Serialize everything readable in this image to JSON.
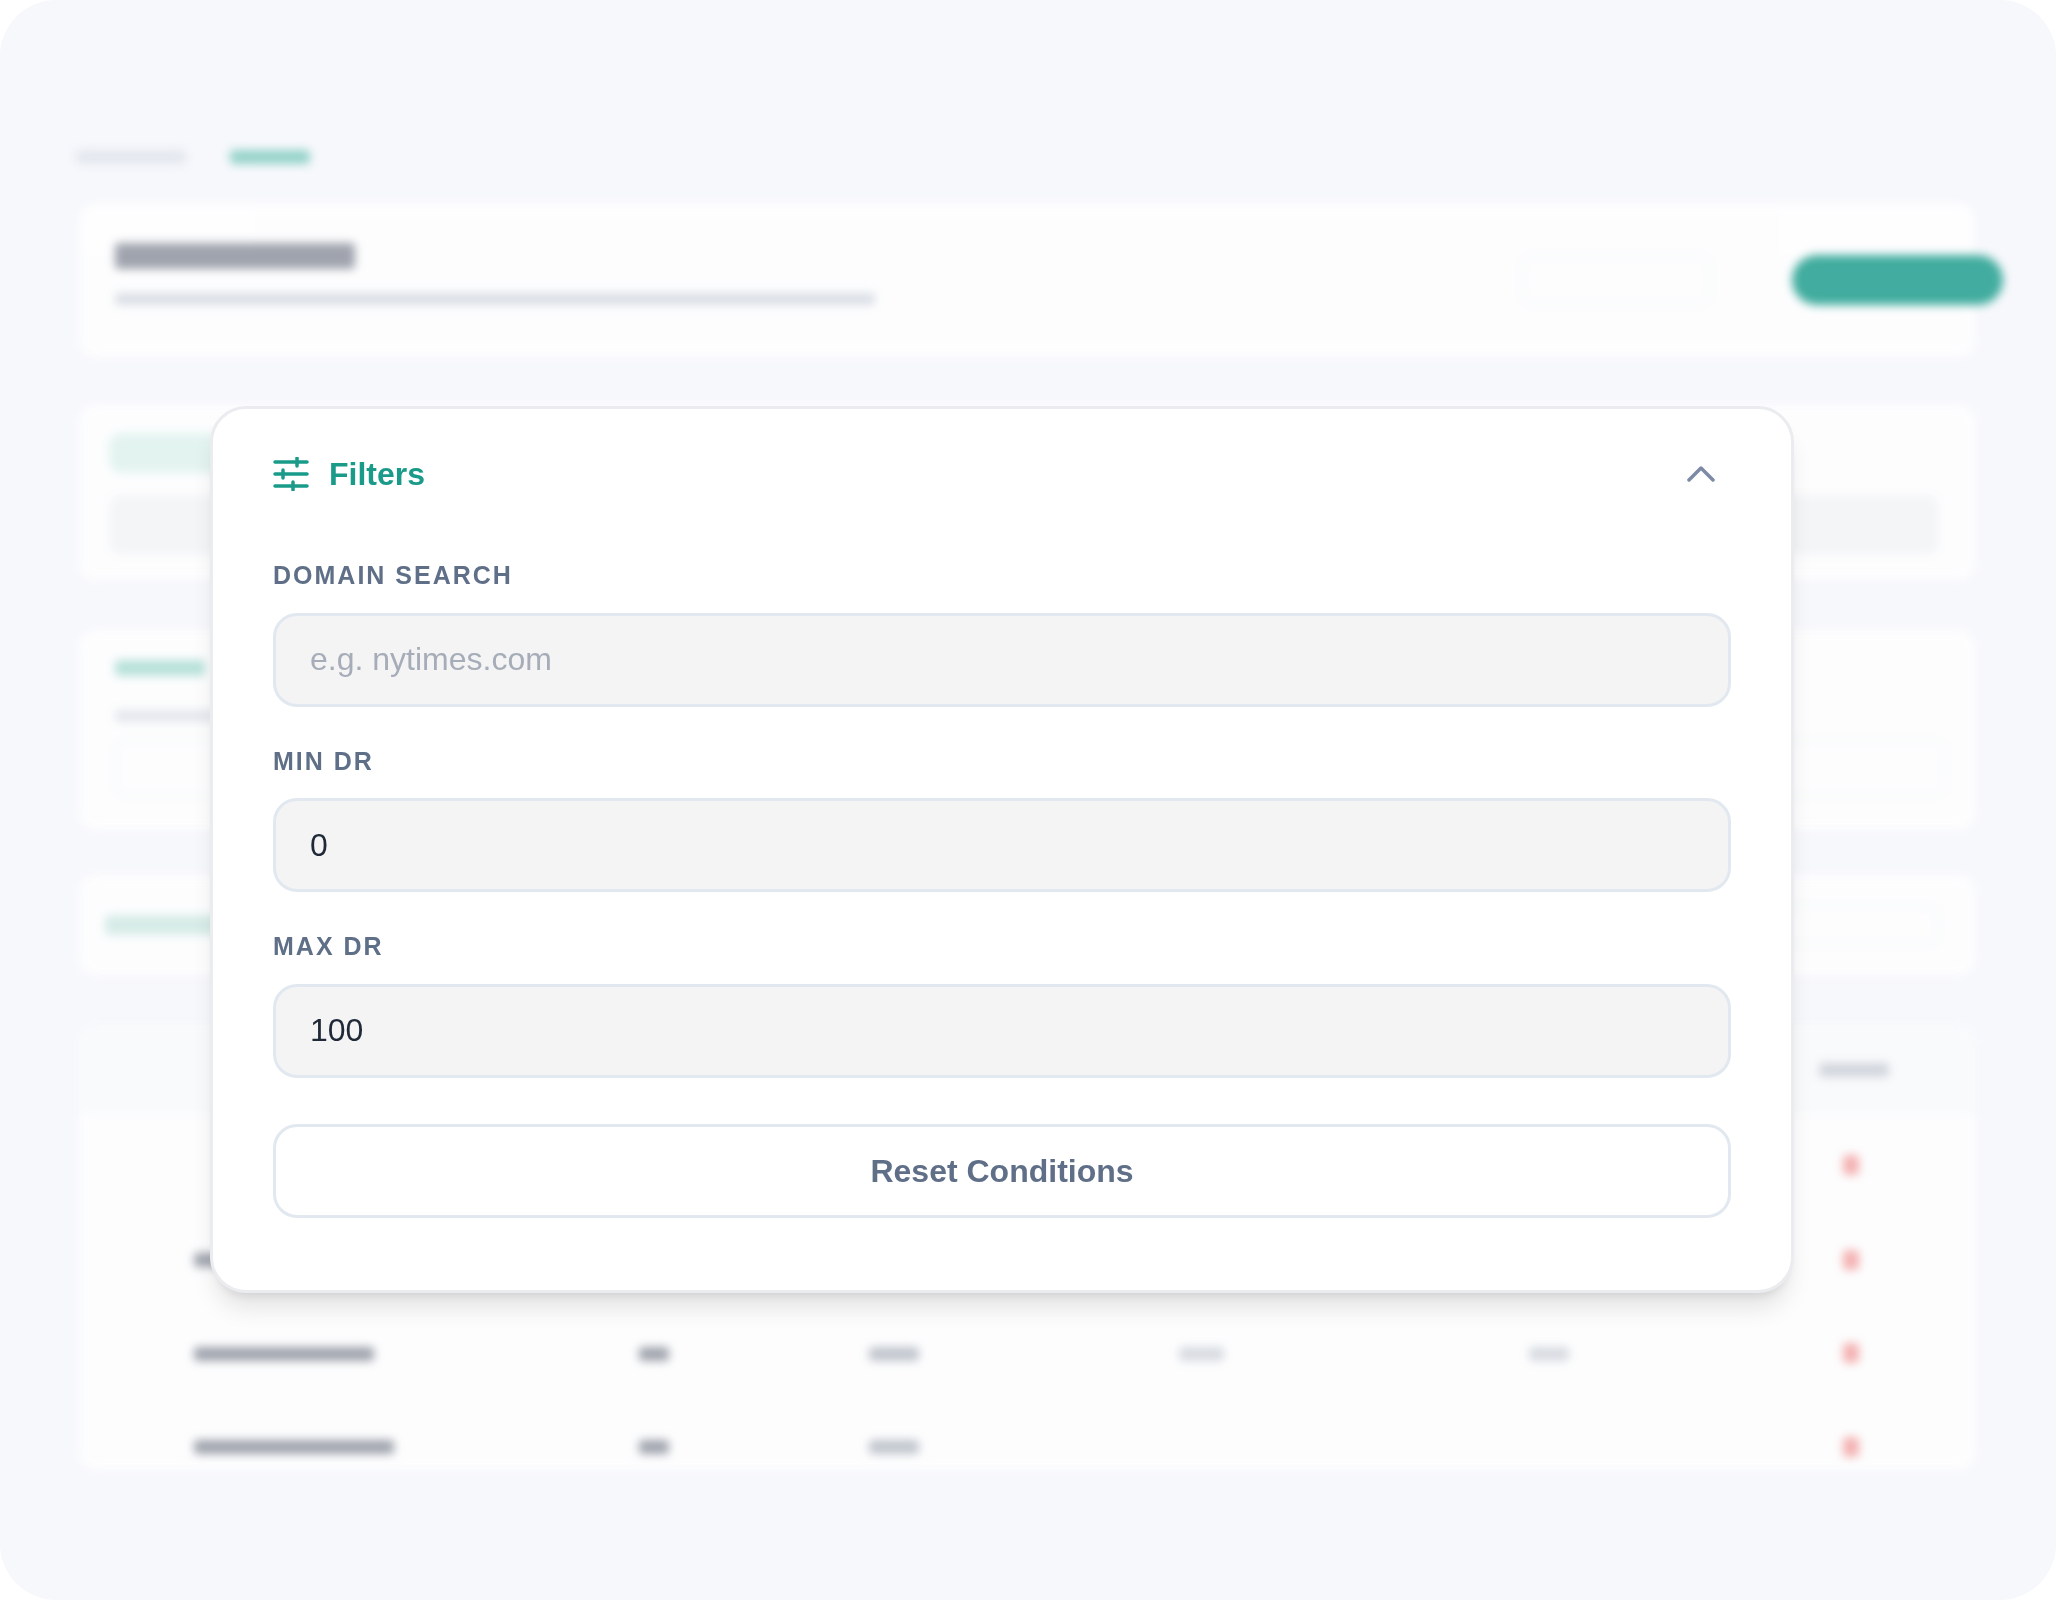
{
  "filters_panel": {
    "title": "Filters",
    "expanded": true,
    "fields": [
      {
        "label": "DOMAIN SEARCH",
        "placeholder": "e.g. nytimes.com"
      },
      {
        "label": "MIN DR",
        "value": "0"
      },
      {
        "label": "MAX DR",
        "value": "100"
      }
    ],
    "reset_button": "Reset Conditions"
  }
}
